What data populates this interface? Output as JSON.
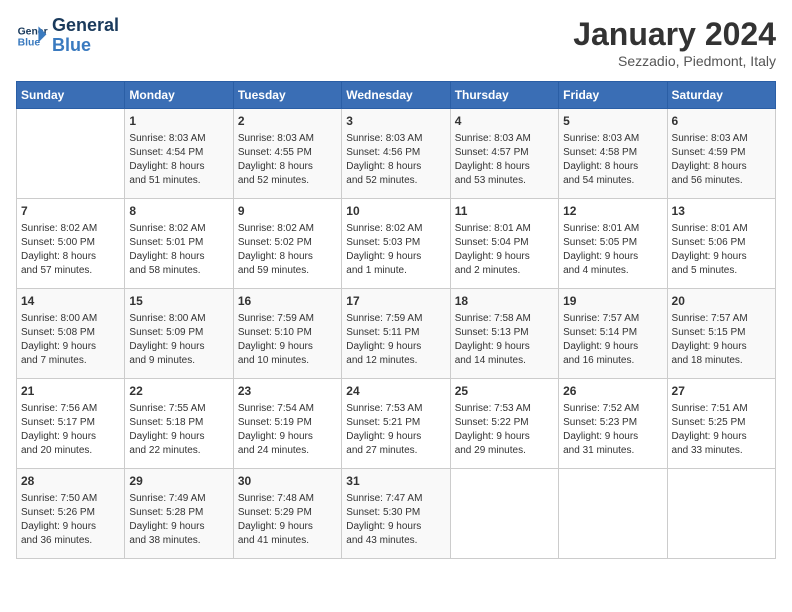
{
  "header": {
    "logo_line1": "General",
    "logo_line2": "Blue",
    "month_title": "January 2024",
    "location": "Sezzadio, Piedmont, Italy"
  },
  "days_of_week": [
    "Sunday",
    "Monday",
    "Tuesday",
    "Wednesday",
    "Thursday",
    "Friday",
    "Saturday"
  ],
  "weeks": [
    [
      {
        "day": "",
        "info": ""
      },
      {
        "day": "1",
        "info": "Sunrise: 8:03 AM\nSunset: 4:54 PM\nDaylight: 8 hours\nand 51 minutes."
      },
      {
        "day": "2",
        "info": "Sunrise: 8:03 AM\nSunset: 4:55 PM\nDaylight: 8 hours\nand 52 minutes."
      },
      {
        "day": "3",
        "info": "Sunrise: 8:03 AM\nSunset: 4:56 PM\nDaylight: 8 hours\nand 52 minutes."
      },
      {
        "day": "4",
        "info": "Sunrise: 8:03 AM\nSunset: 4:57 PM\nDaylight: 8 hours\nand 53 minutes."
      },
      {
        "day": "5",
        "info": "Sunrise: 8:03 AM\nSunset: 4:58 PM\nDaylight: 8 hours\nand 54 minutes."
      },
      {
        "day": "6",
        "info": "Sunrise: 8:03 AM\nSunset: 4:59 PM\nDaylight: 8 hours\nand 56 minutes."
      }
    ],
    [
      {
        "day": "7",
        "info": "Sunrise: 8:02 AM\nSunset: 5:00 PM\nDaylight: 8 hours\nand 57 minutes."
      },
      {
        "day": "8",
        "info": "Sunrise: 8:02 AM\nSunset: 5:01 PM\nDaylight: 8 hours\nand 58 minutes."
      },
      {
        "day": "9",
        "info": "Sunrise: 8:02 AM\nSunset: 5:02 PM\nDaylight: 8 hours\nand 59 minutes."
      },
      {
        "day": "10",
        "info": "Sunrise: 8:02 AM\nSunset: 5:03 PM\nDaylight: 9 hours\nand 1 minute."
      },
      {
        "day": "11",
        "info": "Sunrise: 8:01 AM\nSunset: 5:04 PM\nDaylight: 9 hours\nand 2 minutes."
      },
      {
        "day": "12",
        "info": "Sunrise: 8:01 AM\nSunset: 5:05 PM\nDaylight: 9 hours\nand 4 minutes."
      },
      {
        "day": "13",
        "info": "Sunrise: 8:01 AM\nSunset: 5:06 PM\nDaylight: 9 hours\nand 5 minutes."
      }
    ],
    [
      {
        "day": "14",
        "info": "Sunrise: 8:00 AM\nSunset: 5:08 PM\nDaylight: 9 hours\nand 7 minutes."
      },
      {
        "day": "15",
        "info": "Sunrise: 8:00 AM\nSunset: 5:09 PM\nDaylight: 9 hours\nand 9 minutes."
      },
      {
        "day": "16",
        "info": "Sunrise: 7:59 AM\nSunset: 5:10 PM\nDaylight: 9 hours\nand 10 minutes."
      },
      {
        "day": "17",
        "info": "Sunrise: 7:59 AM\nSunset: 5:11 PM\nDaylight: 9 hours\nand 12 minutes."
      },
      {
        "day": "18",
        "info": "Sunrise: 7:58 AM\nSunset: 5:13 PM\nDaylight: 9 hours\nand 14 minutes."
      },
      {
        "day": "19",
        "info": "Sunrise: 7:57 AM\nSunset: 5:14 PM\nDaylight: 9 hours\nand 16 minutes."
      },
      {
        "day": "20",
        "info": "Sunrise: 7:57 AM\nSunset: 5:15 PM\nDaylight: 9 hours\nand 18 minutes."
      }
    ],
    [
      {
        "day": "21",
        "info": "Sunrise: 7:56 AM\nSunset: 5:17 PM\nDaylight: 9 hours\nand 20 minutes."
      },
      {
        "day": "22",
        "info": "Sunrise: 7:55 AM\nSunset: 5:18 PM\nDaylight: 9 hours\nand 22 minutes."
      },
      {
        "day": "23",
        "info": "Sunrise: 7:54 AM\nSunset: 5:19 PM\nDaylight: 9 hours\nand 24 minutes."
      },
      {
        "day": "24",
        "info": "Sunrise: 7:53 AM\nSunset: 5:21 PM\nDaylight: 9 hours\nand 27 minutes."
      },
      {
        "day": "25",
        "info": "Sunrise: 7:53 AM\nSunset: 5:22 PM\nDaylight: 9 hours\nand 29 minutes."
      },
      {
        "day": "26",
        "info": "Sunrise: 7:52 AM\nSunset: 5:23 PM\nDaylight: 9 hours\nand 31 minutes."
      },
      {
        "day": "27",
        "info": "Sunrise: 7:51 AM\nSunset: 5:25 PM\nDaylight: 9 hours\nand 33 minutes."
      }
    ],
    [
      {
        "day": "28",
        "info": "Sunrise: 7:50 AM\nSunset: 5:26 PM\nDaylight: 9 hours\nand 36 minutes."
      },
      {
        "day": "29",
        "info": "Sunrise: 7:49 AM\nSunset: 5:28 PM\nDaylight: 9 hours\nand 38 minutes."
      },
      {
        "day": "30",
        "info": "Sunrise: 7:48 AM\nSunset: 5:29 PM\nDaylight: 9 hours\nand 41 minutes."
      },
      {
        "day": "31",
        "info": "Sunrise: 7:47 AM\nSunset: 5:30 PM\nDaylight: 9 hours\nand 43 minutes."
      },
      {
        "day": "",
        "info": ""
      },
      {
        "day": "",
        "info": ""
      },
      {
        "day": "",
        "info": ""
      }
    ]
  ]
}
